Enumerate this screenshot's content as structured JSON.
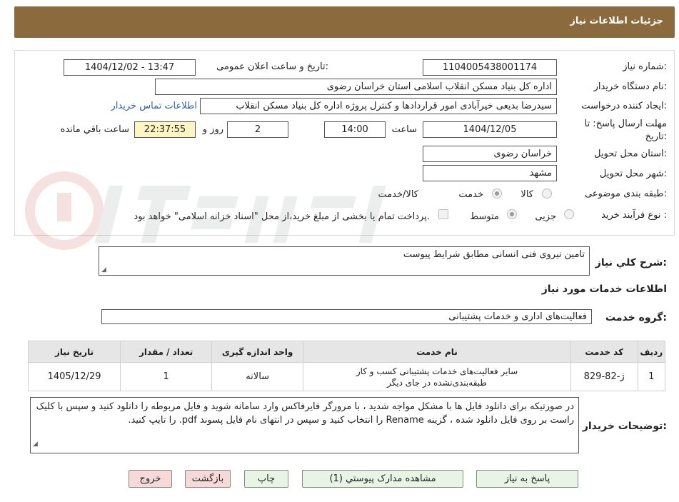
{
  "header": {
    "title": "جزئیات اطلاعات نیاز"
  },
  "form": {
    "need_number_label": "شماره نیاز:",
    "need_number": "1104005438001174",
    "announce_label": "تاریخ و ساعت اعلان عمومی:",
    "announce_value": "1404/12/02 - 13:47",
    "buyer_org_label": "نام دستگاه خریدار:",
    "buyer_org": "اداره کل بنیاد مسکن انقلاب اسلامی استان خراسان رضوی",
    "creator_label": "ایجاد کننده درخواست:",
    "creator": "سیدرضا بدیعی خیرآبادی امور قراردادها و کنترل پروژه اداره کل بنیاد مسکن انقلاب",
    "contact_link": "اطلاعات تماس خریدار",
    "deadline_label_1": "مهلت ارسال پاسخ: تا",
    "deadline_label_2": "تاریخ:",
    "deadline_date": "1404/12/05",
    "time_label": "ساعت",
    "deadline_time": "14:00",
    "days_value": "2",
    "days_label": "روز و",
    "remaining_time": "22:37:55",
    "remaining_label": "ساعت باقي مانده",
    "province_label": "استان محل تحویل:",
    "province": "خراسان رضوی",
    "city_label": "شهر محل تحویل:",
    "city": "مشهد",
    "category_label": "طبقه بندی موضوعی:",
    "category_options": [
      "کالا",
      "خدمت",
      "کالا/خدمت"
    ],
    "category_selected": "خدمت",
    "process_label": "نوع فرآیند خرید :",
    "process_options": [
      "جزیی",
      "متوسط"
    ],
    "process_selected": "متوسط",
    "payment_note": "پرداخت تمام یا بخشی از مبلغ خرید،از محل \"اسناد خزانه اسلامی\" خواهد بود.",
    "description_label": "شرح کلي نیاز:",
    "description": "تامین نیروی فنی انسانی مطابق شرایط پیوست",
    "services_heading": "اطلاعات خدمات مورد نیاز",
    "service_group_label": "گروه خدمت:",
    "service_group": "فعالیت‌های اداری و خدمات پشتیبانی"
  },
  "table": {
    "headers": [
      "ردیف",
      "کد خدمت",
      "نام خدمت",
      "واحد اندازه گیری",
      "تعداد / مقدار",
      "تاریخ نیاز"
    ],
    "rows": [
      {
        "row": "1",
        "code": "ژ-82-829",
        "name_line1": "سایر فعالیت‌های خدمات پشتیبانی کسب و کار",
        "name_line2": "طبقه‌بندی‌نشده در جای دیگر",
        "unit": "سالانه",
        "qty": "1",
        "date": "1405/12/29"
      }
    ]
  },
  "buyer_notes": {
    "label": "توضیحات خریدار:",
    "text": "در صورتیکه برای دانلود فایل ها با مشکل مواجه شدید ، با مرورگر فایرفاکس وارد سامانه شوید و فایل مربوطه را دانلود کنید و سپس با کلیک راست بر روی فایل دانلود شده ، گزینه Rename را انتخاب کنید و سپس در انتهای نام فایل پسوند pdf. را تایپ کنید."
  },
  "buttons": {
    "reply": "پاسخ به نیاز",
    "attachments": "مشاهده مدارک پیوستي (1)",
    "print": "چاپ",
    "back": "بازگشت",
    "exit": "خروج"
  },
  "colors": {
    "header_bg": "#8b6b3d",
    "link": "#2f5fb0",
    "button_green": "#e8f4e4",
    "button_pink": "#f7d9d9",
    "remaining_bg": "#fdf6c3"
  }
}
